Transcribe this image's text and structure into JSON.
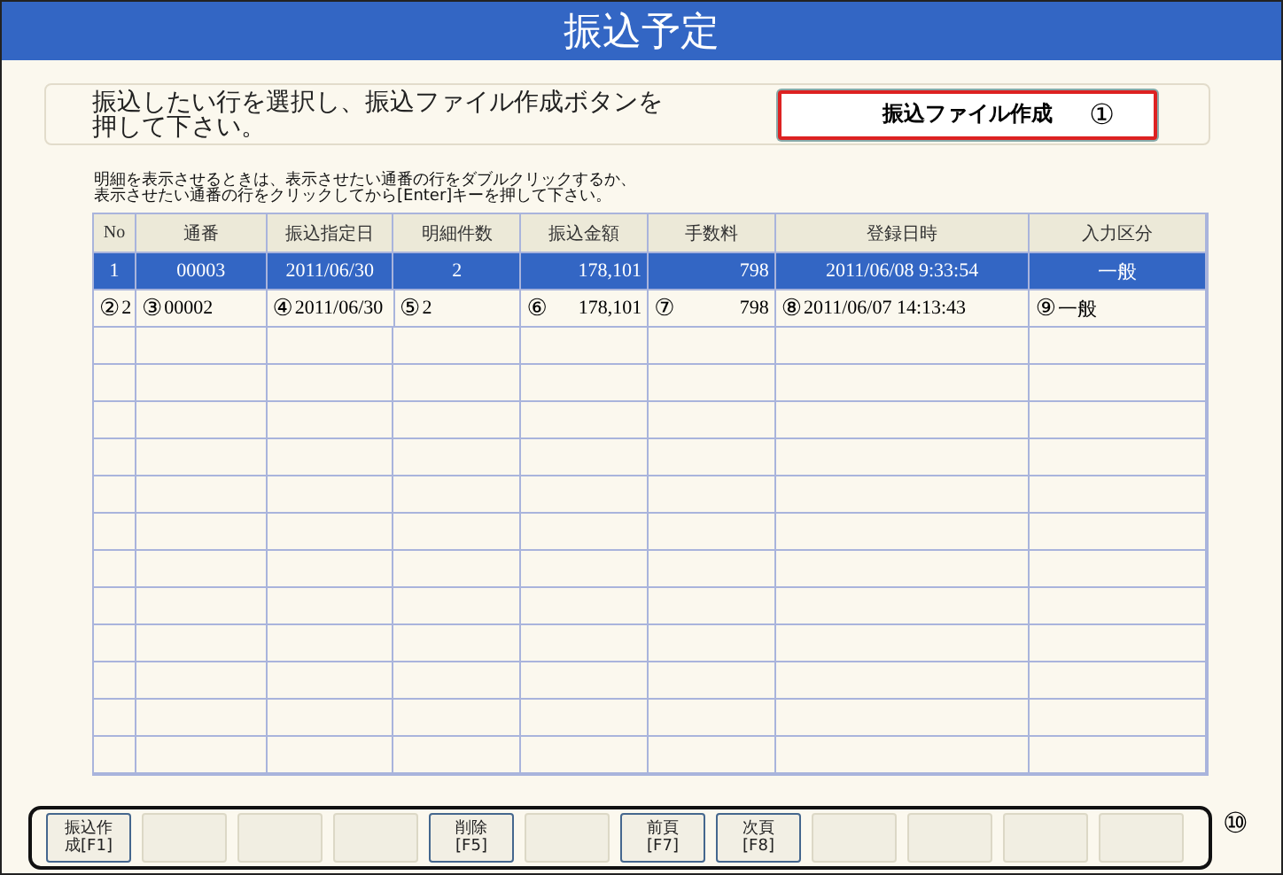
{
  "window": {
    "title": "振込予定"
  },
  "instruction": {
    "lines": [
      "振込したい行を選択し、振込ファイル作成ボタンを",
      "押して下さい。"
    ]
  },
  "create_button": {
    "label": "振込ファイル作成",
    "callout": "①"
  },
  "note": {
    "lines": [
      "明細を表示させるときは、表示させたい通番の行をダブルクリックするか、",
      "表示させたい通番の行をクリックしてから[Enter]キーを押して下さい。"
    ]
  },
  "table": {
    "columns": [
      "No",
      "通番",
      "振込指定日",
      "明細件数",
      "振込金額",
      "手数料",
      "登録日時",
      "入力区分"
    ],
    "rows": [
      {
        "selected": true,
        "cells": [
          {
            "value": "1"
          },
          {
            "value": "00003"
          },
          {
            "value": "2011/06/30"
          },
          {
            "value": "2"
          },
          {
            "value": "178,101"
          },
          {
            "value": "798"
          },
          {
            "value": "2011/06/08 9:33:54"
          },
          {
            "value": "一般"
          }
        ]
      },
      {
        "selected": false,
        "cells": [
          {
            "value": "2",
            "callout": "②"
          },
          {
            "value": "00002",
            "callout": "③"
          },
          {
            "value": "2011/06/30",
            "callout": "④"
          },
          {
            "value": "2",
            "callout": "⑤"
          },
          {
            "value": "178,101",
            "callout": "⑥"
          },
          {
            "value": "798",
            "callout": "⑦"
          },
          {
            "value": "2011/06/07 14:13:43",
            "callout": "⑧"
          },
          {
            "value": "一般",
            "callout": "⑨"
          }
        ]
      }
    ]
  },
  "function_keys": {
    "callout": "⑩",
    "keys": [
      {
        "kind": "key",
        "lines": [
          "振込作",
          "成[F1]"
        ]
      },
      {
        "kind": "blank"
      },
      {
        "kind": "blank"
      },
      {
        "kind": "blank"
      },
      {
        "kind": "key",
        "lines": [
          "削除",
          "[F5]"
        ]
      },
      {
        "kind": "blank"
      },
      {
        "kind": "key",
        "lines": [
          "前頁",
          "[F7]"
        ]
      },
      {
        "kind": "key",
        "lines": [
          "次頁",
          "[F8]"
        ]
      },
      {
        "kind": "blank"
      },
      {
        "kind": "blank"
      },
      {
        "kind": "blank"
      },
      {
        "kind": "blank"
      }
    ]
  }
}
